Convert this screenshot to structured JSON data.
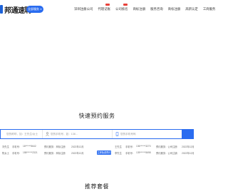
{
  "header": {
    "logo_text": "邦通速聘",
    "service_button": "全部服务",
    "nav": [
      {
        "label": "深圳注册公司",
        "badge": false
      },
      {
        "label": "代理记账",
        "badge": true
      },
      {
        "label": "公司核名",
        "badge": true
      },
      {
        "label": "商标注册",
        "badge": false
      },
      {
        "label": "服务咨询",
        "badge": false
      },
      {
        "label": "商标注册",
        "badge": false
      },
      {
        "label": "高新认定",
        "badge": false
      },
      {
        "label": "工商服务",
        "badge": false
      }
    ]
  },
  "booking": {
    "title": "快速预约服务",
    "name_placeholder": "您的称呼，如：王先生/女士",
    "phone_placeholder": "您的手机号，如：138...",
    "mobile_placeholder": "您的手机号码",
    "submit_label": ""
  },
  "rows": [
    {
      "left": [
        "刘先生",
        "手机号：",
        "18******5642",
        "预约服务：商标注册",
        "2022年12月"
      ],
      "tag": "",
      "right": [
        "王先生",
        "手机号：",
        "136******3270",
        "预约服务：公司注册",
        "2022年12月"
      ]
    },
    {
      "left": [
        "陈女士",
        "手机号：",
        "158******2321",
        "预约服务：商标注册",
        "2022年12月"
      ],
      "tag": "立即免费预约",
      "right": [
        "李先生",
        "手机号：",
        "139******5698",
        "预约服务：公司注销",
        "2022年12月"
      ]
    }
  ],
  "packages": {
    "title": "推荐套餐"
  }
}
